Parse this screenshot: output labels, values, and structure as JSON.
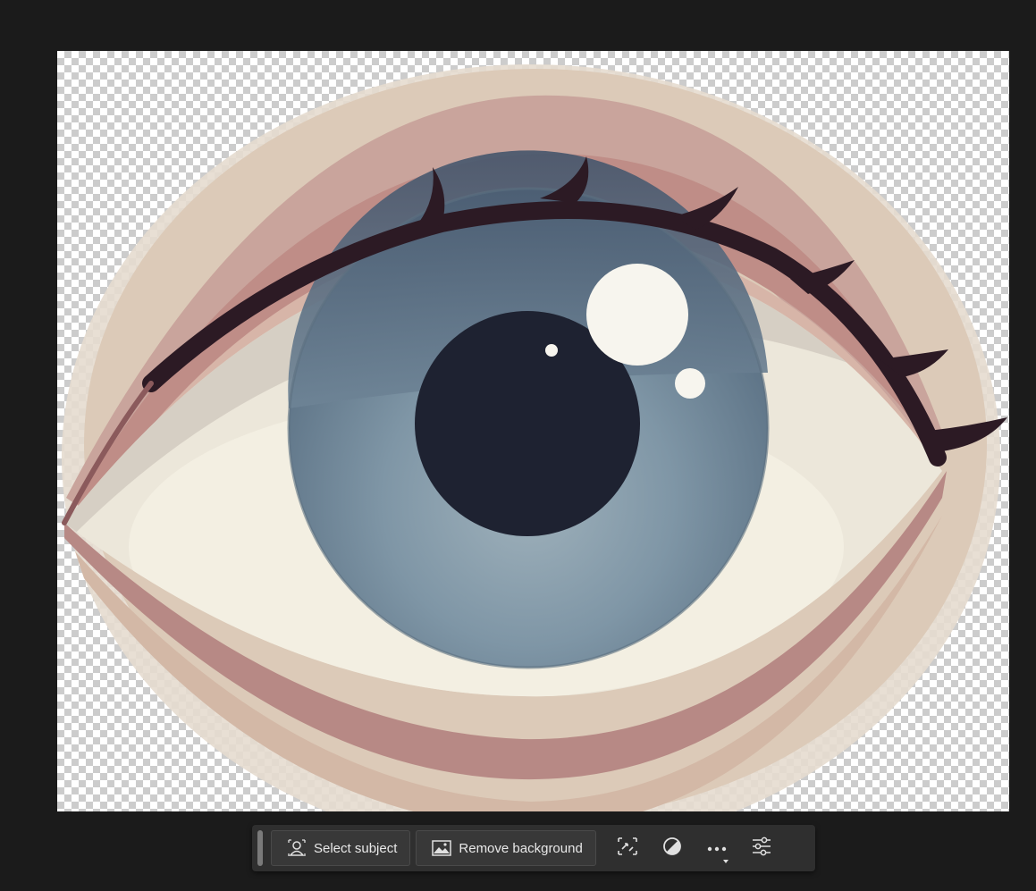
{
  "taskbar": {
    "select_subject_label": "Select subject",
    "remove_background_label": "Remove background"
  },
  "icons": {
    "select_subject": "select-subject-icon",
    "remove_background": "image-icon",
    "transform": "transform-selection-icon",
    "adjustment": "half-circle-adjustment-icon",
    "more": "more-options-icon",
    "settings": "sliders-icon"
  },
  "colors": {
    "app_background": "#1b1b1b",
    "taskbar_background": "#2f2f2f",
    "button_background": "#383838",
    "iris": "#6e8496",
    "pupil": "#1e2231",
    "eyelid": "#c4928c",
    "skin": "#d9c0ad",
    "lash": "#2c1a24"
  }
}
